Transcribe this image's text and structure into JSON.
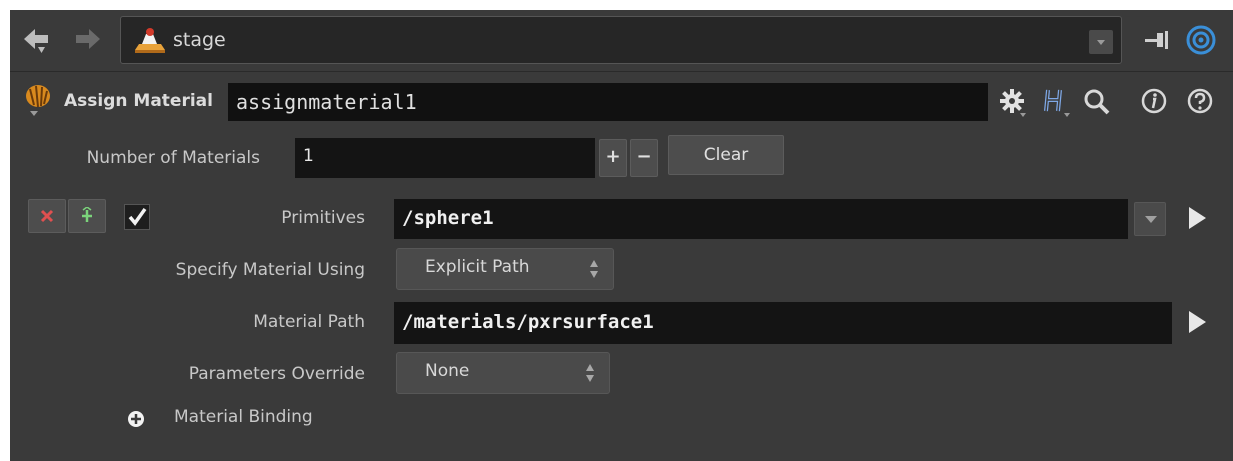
{
  "pathbar": {
    "path": "stage",
    "icons": [
      "back-arrow-icon",
      "forward-arrow-icon",
      "stage-icon",
      "pin-icon",
      "link-icon"
    ]
  },
  "node": {
    "type_label": "Assign Material",
    "name": "assignmaterial1",
    "icons": [
      "gear-icon",
      "houdini-h-icon",
      "search-icon",
      "info-icon",
      "help-icon"
    ]
  },
  "params": {
    "num_materials_label": "Number of Materials",
    "num_materials_value": "1",
    "plus_label": "+",
    "minus_label": "−",
    "clear_label": "Clear",
    "primitives_label": "Primitives",
    "primitives_value": "/sphere1",
    "specify_label": "Specify Material Using",
    "specify_value": "Explicit Path",
    "material_path_label": "Material Path",
    "material_path_value": "/materials/pxrsurface1",
    "params_override_label": "Parameters Override",
    "params_override_value": "None",
    "binding_label": "Material Binding",
    "enabled": true
  },
  "colors": {
    "panel_bg": "#3a3a3a",
    "field_bg": "#141414",
    "link_blue": "#3a8fd8",
    "remove_red": "#e05050",
    "insert_green": "#7bd37b"
  }
}
